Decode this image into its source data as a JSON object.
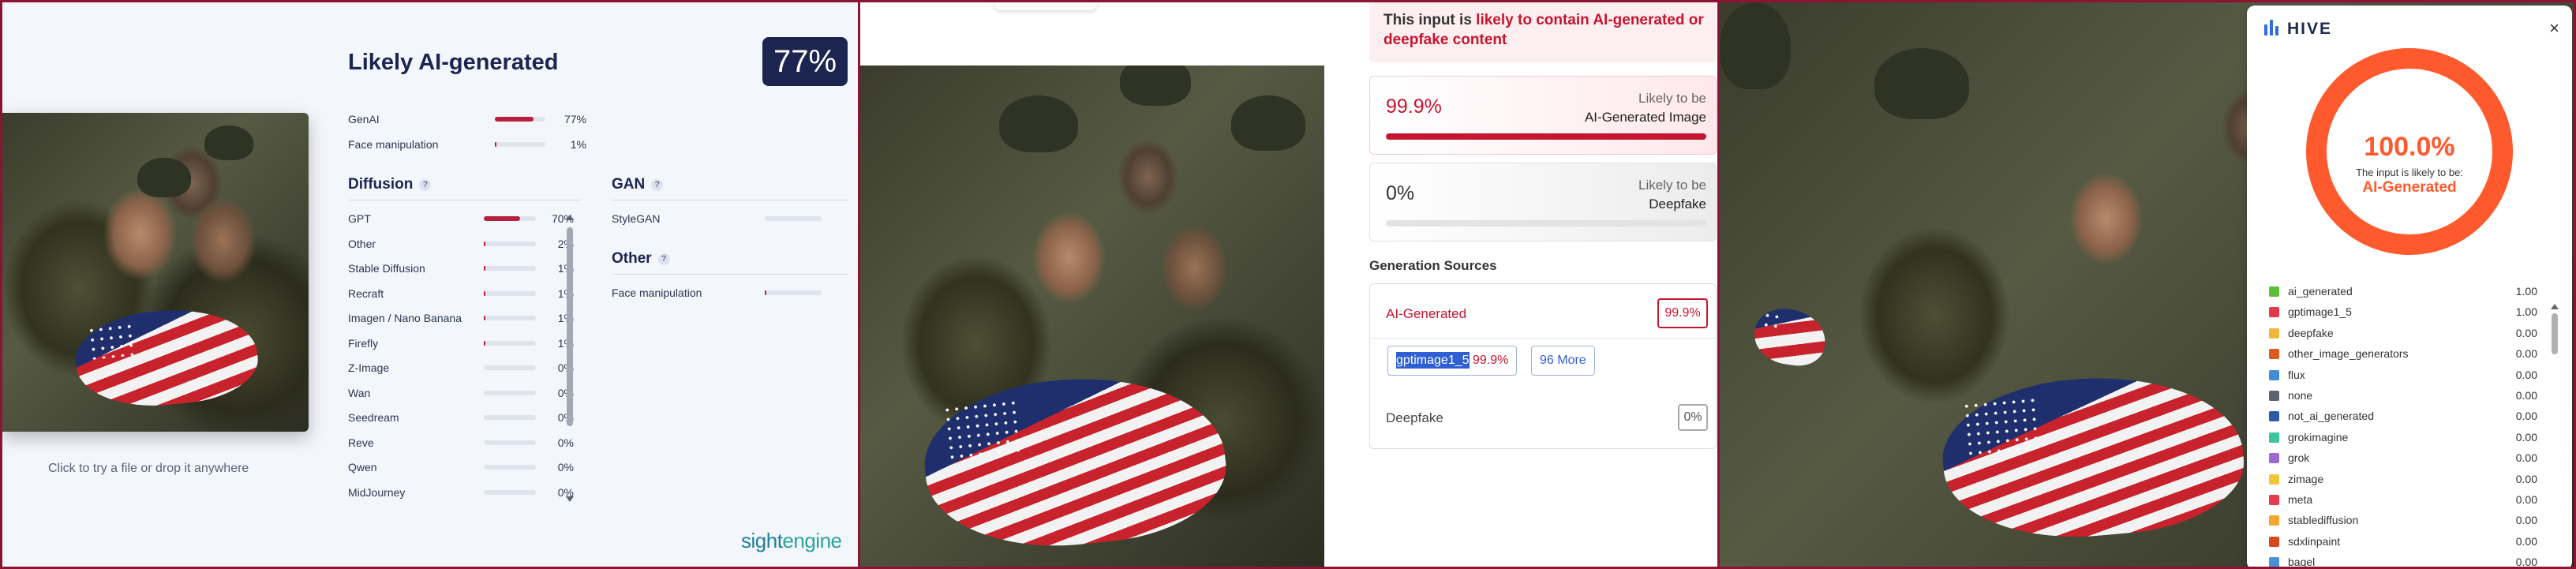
{
  "colors": {
    "accent_red": "#b6203c",
    "navy": "#1b2550",
    "hive_orange": "#ff5a2d",
    "teal": "#2aa39c"
  },
  "sightengine": {
    "title": "Likely AI-generated",
    "score": "77%",
    "drop_hint": "Click to try a file or drop it anywhere",
    "logo": {
      "part1": "sight",
      "part2": "engine"
    },
    "summary": [
      {
        "label": "GenAI",
        "pct": "77%",
        "value": 77
      },
      {
        "label": "Face manipulation",
        "pct": "1%",
        "value": 1
      }
    ],
    "diffusion": {
      "title": "Diffusion",
      "help": "?",
      "items": [
        {
          "label": "GPT",
          "pct": "70%",
          "value": 70
        },
        {
          "label": "Other",
          "pct": "2%",
          "value": 2
        },
        {
          "label": "Stable Diffusion",
          "pct": "1%",
          "value": 1
        },
        {
          "label": "Recraft",
          "pct": "1%",
          "value": 1
        },
        {
          "label": "Imagen / Nano Banana",
          "pct": "1%",
          "value": 1
        },
        {
          "label": "Firefly",
          "pct": "1%",
          "value": 1
        },
        {
          "label": "Z-Image",
          "pct": "0%",
          "value": 0
        },
        {
          "label": "Wan",
          "pct": "0%",
          "value": 0
        },
        {
          "label": "Seedream",
          "pct": "0%",
          "value": 0
        },
        {
          "label": "Reve",
          "pct": "0%",
          "value": 0
        },
        {
          "label": "Qwen",
          "pct": "0%",
          "value": 0
        },
        {
          "label": "MidJourney",
          "pct": "0%",
          "value": 0
        }
      ]
    },
    "gan": {
      "title": "GAN",
      "help": "?",
      "items": [
        {
          "label": "StyleGAN",
          "pct": "0%",
          "value": 0
        }
      ]
    },
    "other": {
      "title": "Other",
      "help": "?",
      "items": [
        {
          "label": "Face manipulation",
          "pct": "1%",
          "value": 1
        }
      ]
    }
  },
  "detector2": {
    "alert": {
      "prefix": "This input is ",
      "highlight": "likely to contain AI-generated or deepfake content"
    },
    "cards": [
      {
        "value": "99.9%",
        "line1": "Likely to be",
        "line2": "AI-Generated Image",
        "fill": 99.9
      },
      {
        "value": "0%",
        "line1": "Likely to be",
        "line2": "Deepfake",
        "fill": 0
      }
    ],
    "sources_title": "Generation Sources",
    "ai_label": "AI-Generated",
    "ai_score": "99.9%",
    "chip_model": "gptimage1_5",
    "chip_score": "99.9%",
    "more": "96 More",
    "deepfake_label": "Deepfake",
    "deepfake_score": "0%"
  },
  "hive": {
    "brand": "HIVE",
    "close": "×",
    "score": "100.0%",
    "caption": "The input is likely to be:",
    "verdict": "AI-Generated",
    "classes": [
      {
        "name": "ai_generated",
        "score": "1.00",
        "color": "#5bbf3a"
      },
      {
        "name": "gptimage1_5",
        "score": "1.00",
        "color": "#e23a4b"
      },
      {
        "name": "deepfake",
        "score": "0.00",
        "color": "#f2b63a"
      },
      {
        "name": "other_image_generators",
        "score": "0.00",
        "color": "#e0591f"
      },
      {
        "name": "flux",
        "score": "0.00",
        "color": "#3f8fd6"
      },
      {
        "name": "none",
        "score": "0.00",
        "color": "#5d6470"
      },
      {
        "name": "not_ai_generated",
        "score": "0.00",
        "color": "#2a5aa8"
      },
      {
        "name": "grokimagine",
        "score": "0.00",
        "color": "#3cc7a0"
      },
      {
        "name": "grok",
        "score": "0.00",
        "color": "#9a6ad1"
      },
      {
        "name": "zimage",
        "score": "0.00",
        "color": "#f0c53a"
      },
      {
        "name": "meta",
        "score": "0.00",
        "color": "#e8394e"
      },
      {
        "name": "stablediffusion",
        "score": "0.00",
        "color": "#f5a632"
      },
      {
        "name": "sdxlinpaint",
        "score": "0.00",
        "color": "#d8471e"
      },
      {
        "name": "bagel",
        "score": "0.00",
        "color": "#4a90d9"
      }
    ]
  }
}
